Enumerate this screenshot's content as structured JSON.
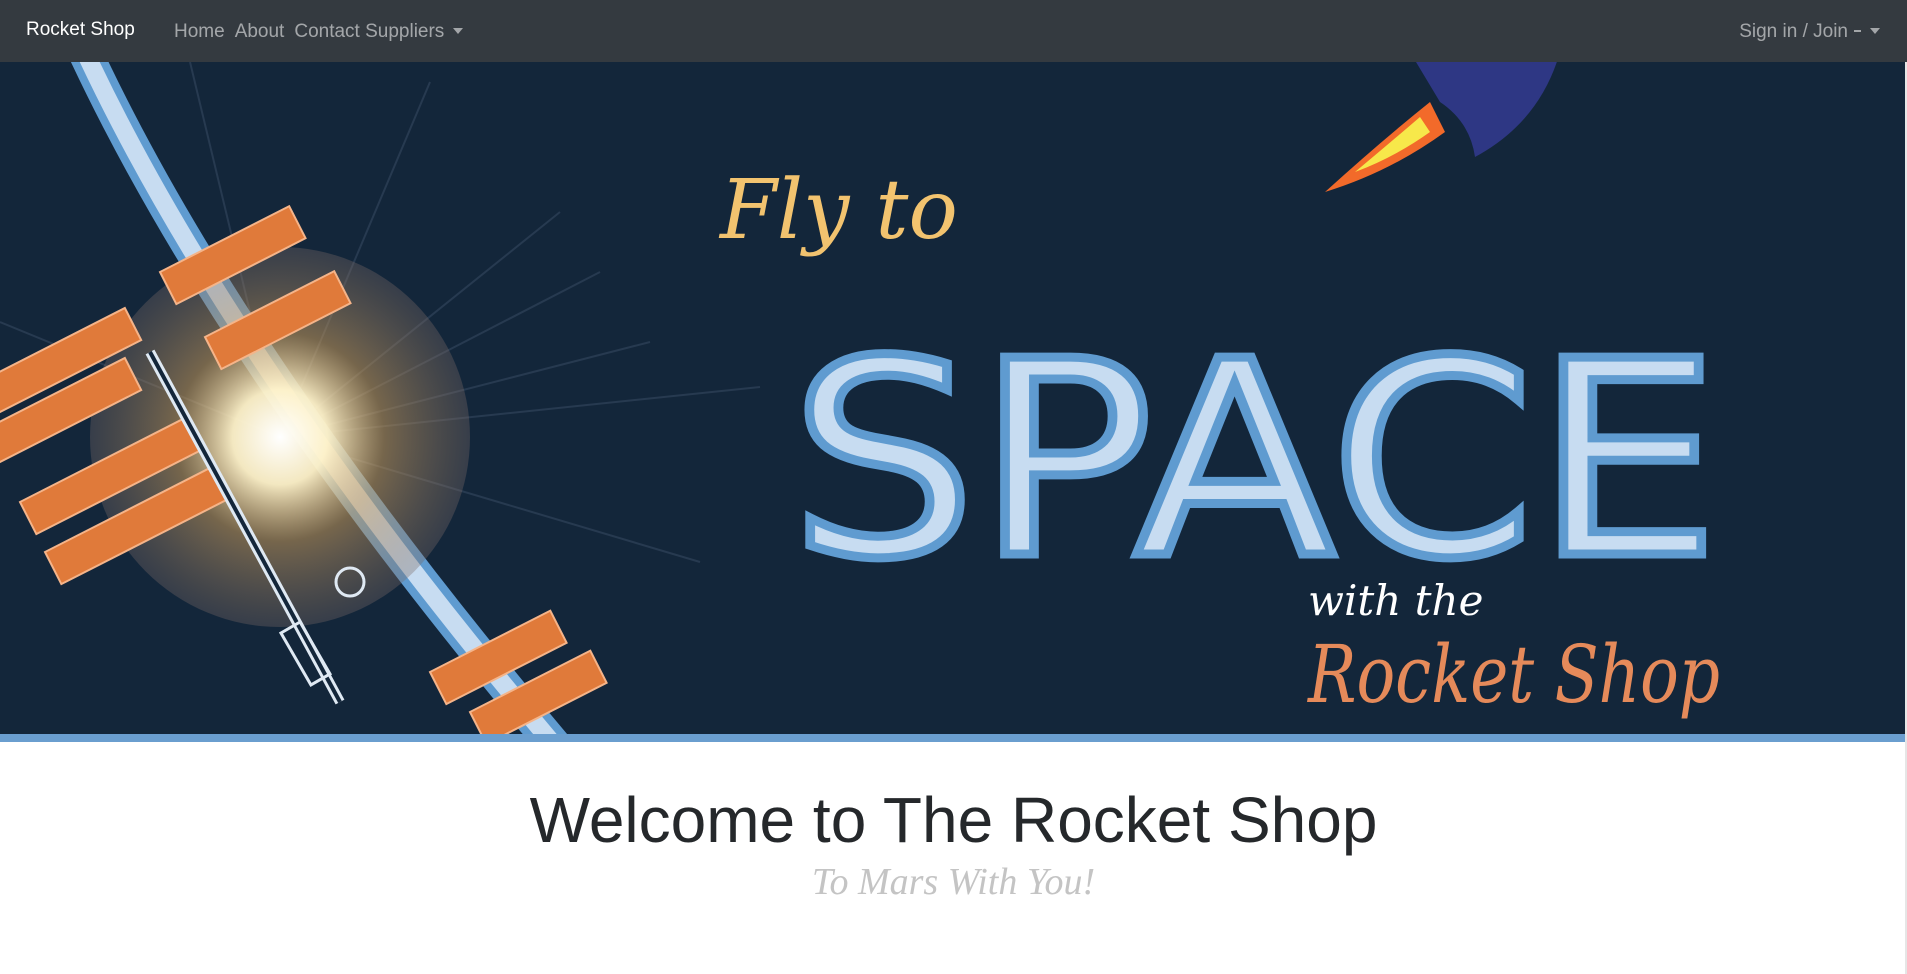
{
  "navbar": {
    "brand": "Rocket Shop",
    "links": [
      "Home",
      "About",
      "Contact Suppliers"
    ],
    "account_menu": "Sign in / Join"
  },
  "hero": {
    "line1": "Fly to",
    "line2": "SPACE",
    "line3": "with the",
    "line4": "Rocket Shop",
    "colors": {
      "background": "#13263a",
      "space_fill": "#c7dcf1",
      "space_outline": "#5f9bd0",
      "fly_text": "#f2c36f",
      "rocket_shop_text": "#e58a5a",
      "panel_orange": "#e07a3a",
      "stripe": "#6a9ecf"
    },
    "icons": [
      "rocket-icon",
      "space-station-illustration"
    ]
  },
  "main": {
    "title": "Welcome to The Rocket Shop",
    "tagline": "To Mars With You!"
  }
}
